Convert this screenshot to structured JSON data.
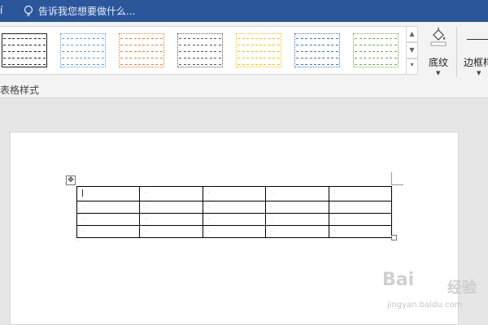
{
  "titlebar": {
    "edge_text": "í",
    "tell_me_placeholder": "告诉我您想要做什么..."
  },
  "ribbon": {
    "group_label": "表格样式",
    "table_styles": [
      {
        "name": "plain-grid",
        "accent": "#222222"
      },
      {
        "name": "grid-accent-1",
        "accent": "#5b9bd5"
      },
      {
        "name": "grid-accent-2",
        "accent": "#ed7d31"
      },
      {
        "name": "grid-accent-3",
        "accent": "#555555"
      },
      {
        "name": "grid-accent-4",
        "accent": "#ffc000"
      },
      {
        "name": "grid-accent-5",
        "accent": "#4472c4"
      },
      {
        "name": "grid-accent-6",
        "accent": "#70ad47"
      }
    ],
    "scroll_up": "▲",
    "scroll_down": "▼",
    "scroll_more": "▾",
    "shading_label": "底纹",
    "borders_label": "边框样",
    "dropdown_caret": "▼"
  },
  "document": {
    "move_handle": "✥",
    "table_rows": [
      [
        "",
        "·",
        "·",
        "·",
        "·"
      ],
      [
        "·",
        "·",
        "·",
        "·",
        "·"
      ],
      [
        "·",
        "·",
        "·",
        "·",
        "·"
      ],
      [
        "·",
        "·",
        "·",
        "·",
        "·"
      ]
    ],
    "row_end_mark": "·"
  },
  "watermark": {
    "brand": "Bai",
    "site": "jingyan.baidu.com",
    "product": "经验"
  },
  "colors": {
    "title_bar": "#2b579a",
    "ribbon_bg": "#f3f3f3",
    "workspace_bg": "#e6e6e6"
  }
}
